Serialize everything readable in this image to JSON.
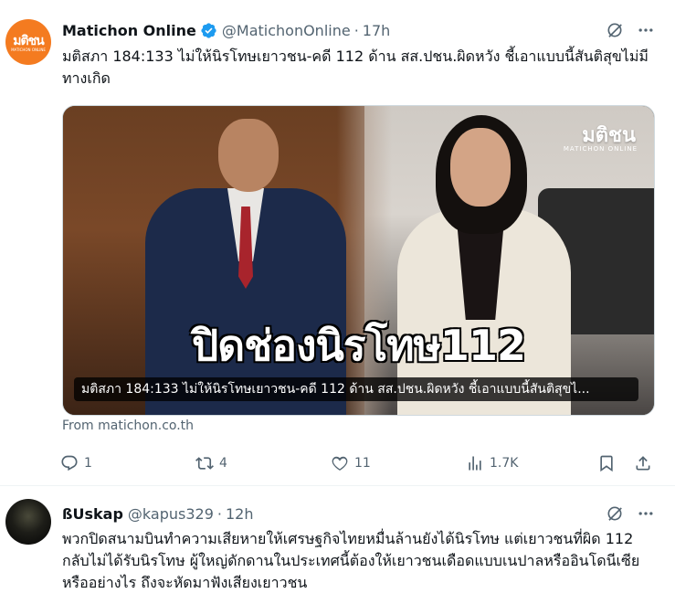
{
  "tweets": [
    {
      "author_name": "Matichon Online",
      "handle": "@MatichonOnline",
      "time": "17h",
      "avatar_text": "มติชน",
      "avatar_subtext": "MATICHON ONLINE",
      "text": "มติสภา 184:133 ไม่ให้นิรโทษเยาวชน-คดี 112 ด้าน สส.ปชน.ผิดหวัง ชี้เอาแบบนี้สันติสุขไม่มีทางเกิด",
      "media": {
        "watermark": "มติชน",
        "watermark_sub": "MATICHON ONLINE",
        "headline": "ปิดช่องนิรโทษ112",
        "caption": "มติสภา 184:133 ไม่ให้นิรโทษเยาวชน-คดี 112 ด้าน สส.ปชน.ผิดหวัง ชี้เอาแบบนี้สันติสุขไ..."
      },
      "source": "From matichon.co.th",
      "stats": {
        "replies": "1",
        "reposts": "4",
        "likes": "11",
        "views": "1.7K"
      }
    },
    {
      "author_name": "ßUskap",
      "handle": "@kapus329",
      "time": "12h",
      "text": "พวกปิดสนามบินทำความเสียหายให้เศรษฐกิจไทยหมื่นล้านยังได้นิรโทษ แต่เยาวชนที่ผิด 112 กลับไม่ได้รับนิรโทษ ผู้ใหญ่ดักดานในประเทศนี้ต้องให้เยาวชนเดือดแบบเนปาลหรืออินโดนีเซียหรืออย่างไร ถึงจะหัดมาฟังเสียงเยาวชน"
    }
  ],
  "icons": {
    "verified": "verified-badge-icon",
    "grok": "grok-icon",
    "more": "more-icon",
    "reply": "reply-icon",
    "repost": "repost-icon",
    "like": "like-icon",
    "views": "views-icon",
    "bookmark": "bookmark-icon",
    "share": "share-icon"
  },
  "colors": {
    "accent": "#1d9bf0",
    "secondary_text": "#536471",
    "avatar_brand": "#f47b20"
  }
}
